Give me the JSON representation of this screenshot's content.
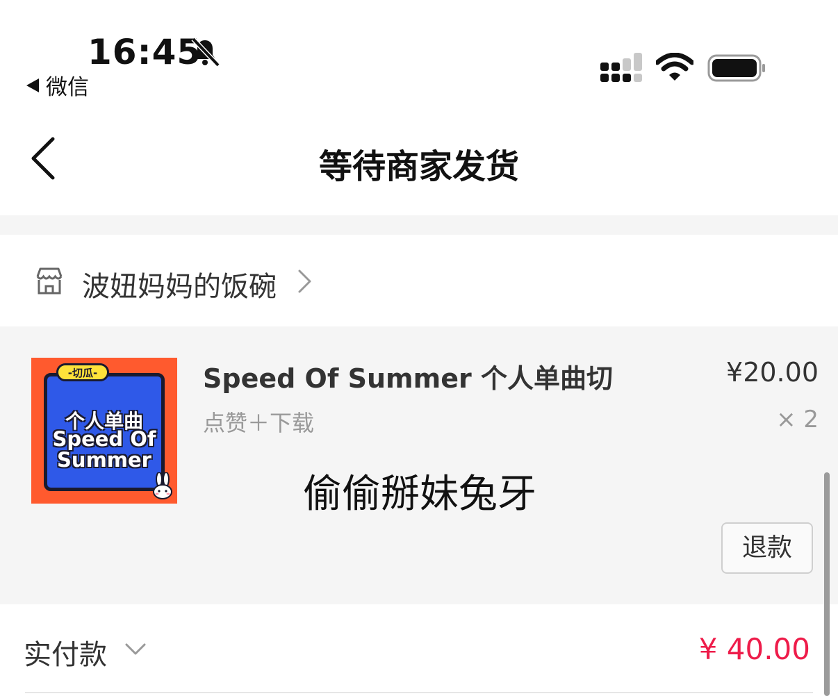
{
  "status_bar": {
    "time": "16:45",
    "back_app_label": "微信"
  },
  "nav": {
    "title": "等待商家发货"
  },
  "shop": {
    "name": "波妞妈妈的饭碗"
  },
  "product": {
    "thumbnail": {
      "tag": "-切瓜-",
      "line1": "个人单曲",
      "line2": "Speed Of",
      "line3": "Summer"
    },
    "title": "Speed Of Summer 个人单曲切",
    "price": "¥20.00",
    "spec": "点赞＋下载",
    "quantity": "× 2",
    "note": "偷偷掰妹兔牙",
    "refund_label": "退款"
  },
  "total": {
    "label": "实付款",
    "amount": "¥ 40.00"
  },
  "colors": {
    "accent_price": "#ee1c4a",
    "card_bg": "#f5f5f5",
    "thumb_orange": "#ff5a2e",
    "thumb_blue": "#2f59e8",
    "thumb_yellow": "#ffe23a"
  },
  "icons": [
    "bell-slash-icon",
    "back-triangle-icon",
    "cellular-signal-icon",
    "wifi-icon",
    "battery-icon",
    "chevron-left-icon",
    "shop-icon",
    "chevron-right-icon",
    "chevron-down-icon",
    "bunny-icon"
  ]
}
